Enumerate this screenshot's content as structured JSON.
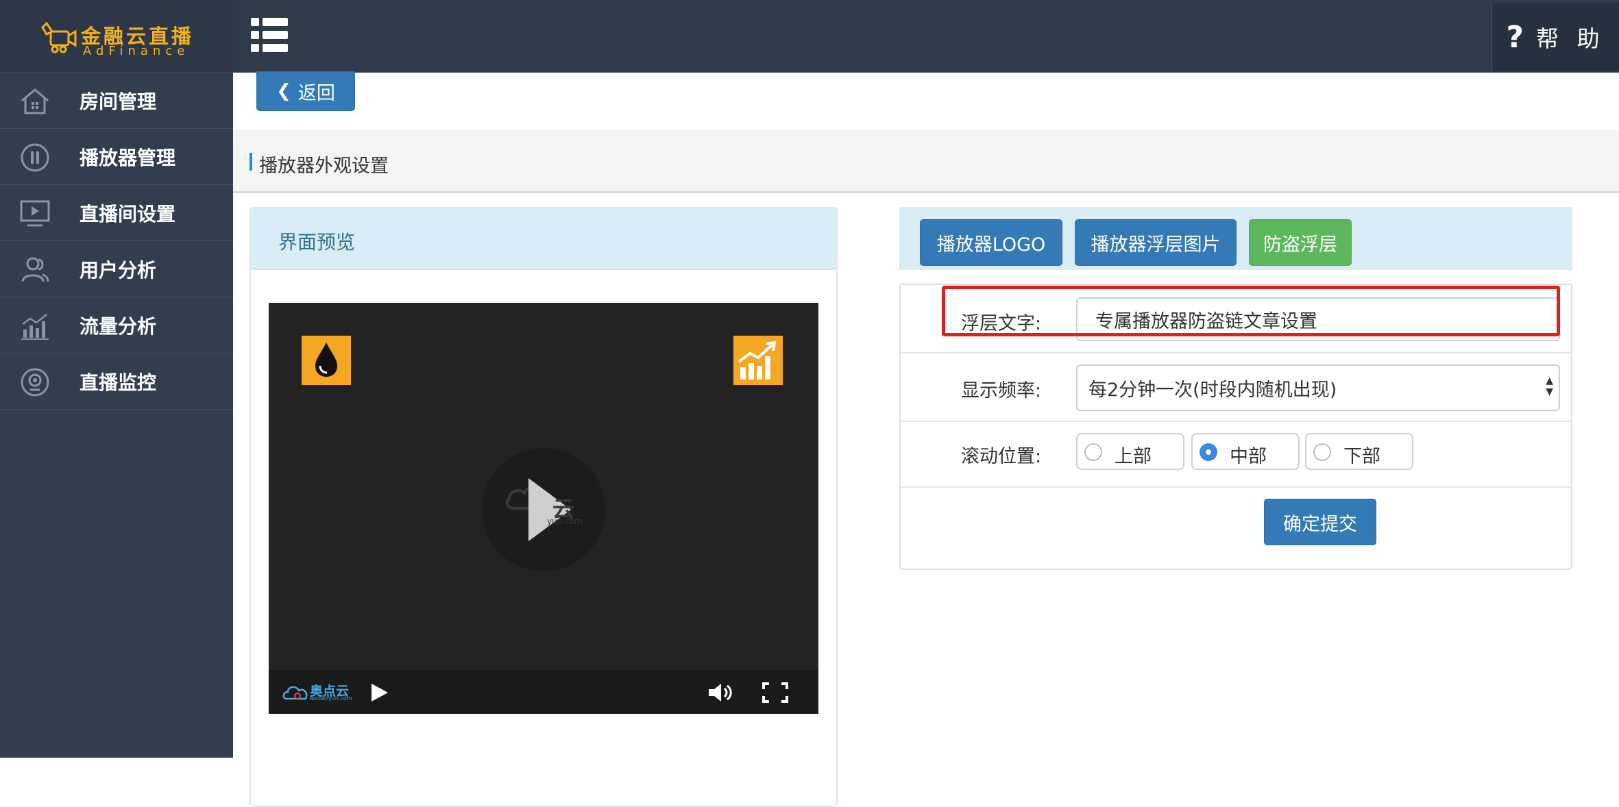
{
  "brand": {
    "name_cn": "金融云直播",
    "name_en": "AdFinance",
    "accent_color": "#f2b21c"
  },
  "header": {
    "help_label": "帮 助",
    "help_icon": "question-icon",
    "menu_icon": "list-icon"
  },
  "sidebar": {
    "items": [
      {
        "label": "房间管理",
        "icon": "home-icon"
      },
      {
        "label": "播放器管理",
        "icon": "pause-circle-icon"
      },
      {
        "label": "直播间设置",
        "icon": "monitor-play-icon"
      },
      {
        "label": "用户分析",
        "icon": "users-icon"
      },
      {
        "label": "流量分析",
        "icon": "bar-chart-icon"
      },
      {
        "label": "直播监控",
        "icon": "camera-icon"
      }
    ]
  },
  "main": {
    "back_label": "返回",
    "section_title": "播放器外观设置",
    "preview": {
      "title": "界面预览",
      "watermark_text": "云",
      "watermark_sub": "yun.com",
      "control_brand": "奥点云",
      "control_brand_sub": "aodianyun.com"
    },
    "tabs": [
      {
        "label": "播放器LOGO",
        "color": "#337ab7"
      },
      {
        "label": "播放器浮层图片",
        "color": "#337ab7"
      },
      {
        "label": "防盗浮层",
        "color": "#5cb85c"
      }
    ],
    "form": {
      "overlay_text_label": "浮层文字:",
      "overlay_text_value": "专属播放器防盗链文章设置",
      "frequency_label": "显示频率:",
      "frequency_value": "每2分钟一次(时段内随机出现)",
      "position_label": "滚动位置:",
      "position_options": [
        {
          "label": "上部",
          "selected": false
        },
        {
          "label": "中部",
          "selected": true
        },
        {
          "label": "下部",
          "selected": false
        }
      ],
      "submit_label": "确定提交"
    }
  }
}
